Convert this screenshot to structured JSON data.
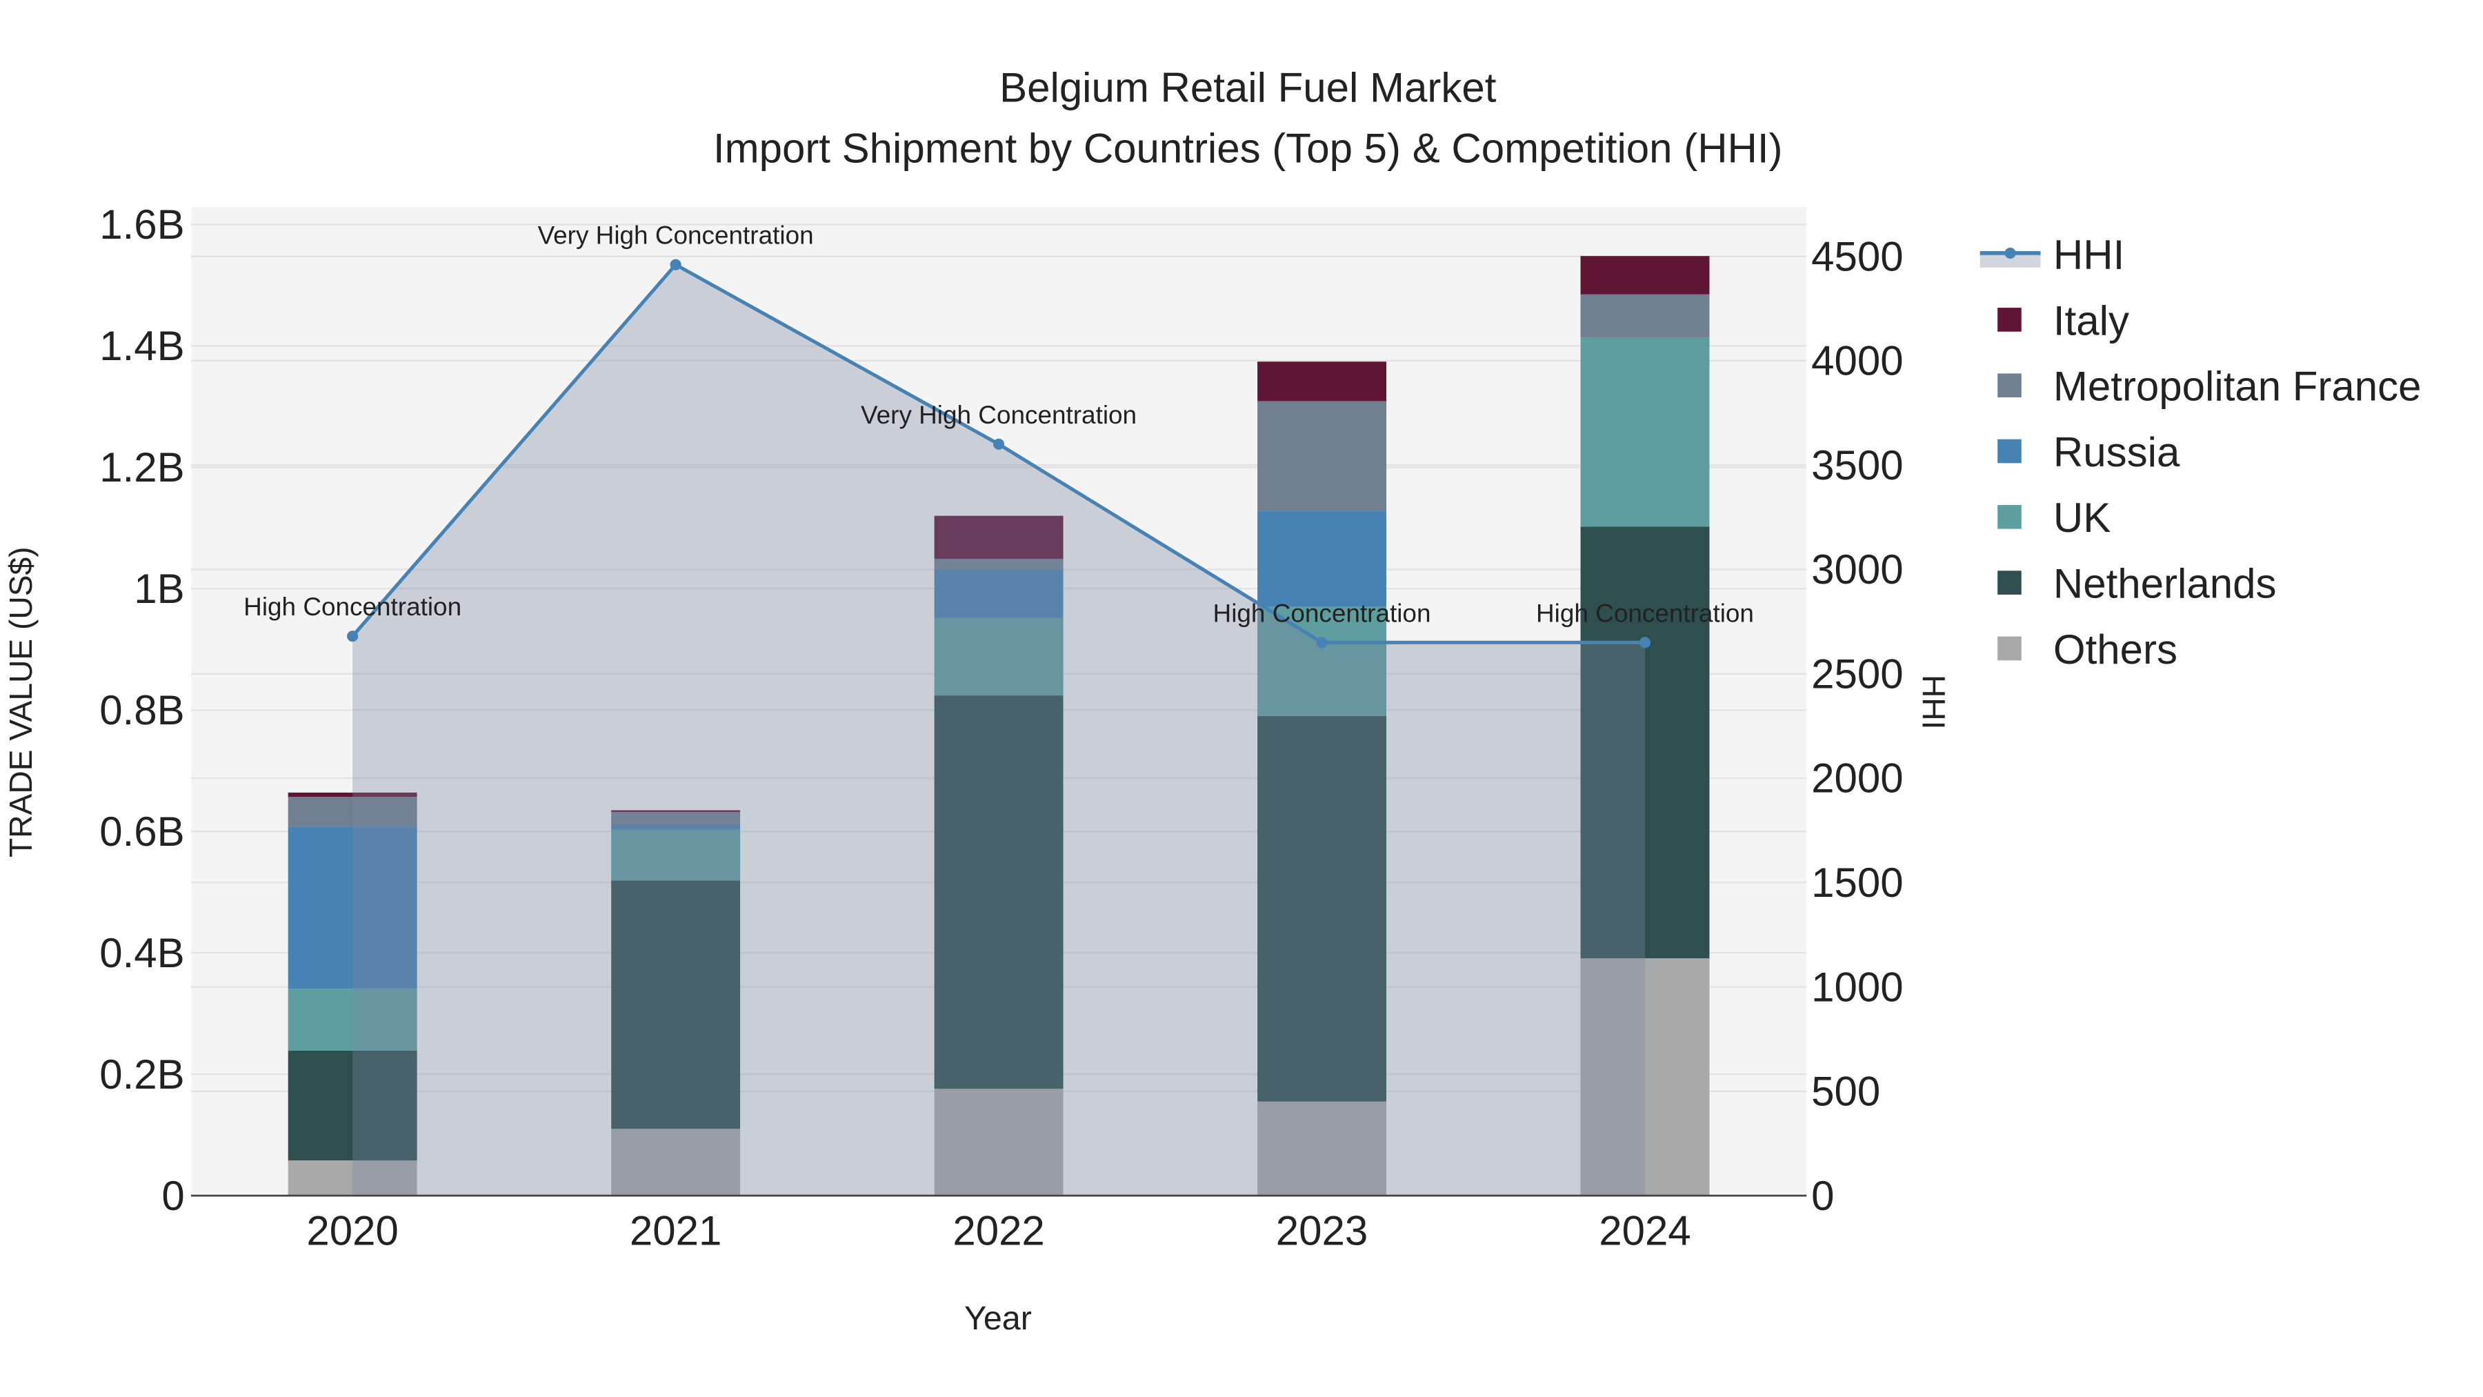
{
  "chart_data": {
    "type": "bar",
    "title": "Belgium Retail Fuel Market",
    "subtitle": "Import Shipment by Countries (Top 5) & Competition (HHI)",
    "xlabel": "Year",
    "ylabel": "TRADE VALUE (US$)",
    "y2label": "HHI",
    "categories": [
      "2020",
      "2021",
      "2022",
      "2023",
      "2024"
    ],
    "ylim": [
      0,
      1.6
    ],
    "yticks": [
      0,
      0.2,
      0.4,
      0.6,
      0.8,
      1.0,
      1.2,
      1.4,
      1.6
    ],
    "ytick_labels": [
      "0",
      "0.2B",
      "0.4B",
      "0.6B",
      "0.8B",
      "1B",
      "1.2B",
      "1.4B",
      "1.6B"
    ],
    "y2lim": [
      0,
      4500
    ],
    "y2ticks": [
      0,
      500,
      1000,
      1500,
      2000,
      2500,
      3000,
      3500,
      4000,
      4500
    ],
    "y2tick_labels": [
      "0",
      "500",
      "1000",
      "1500",
      "2000",
      "2500",
      "3000",
      "3500",
      "4000",
      "4500"
    ],
    "units": "billion US$",
    "series": [
      {
        "name": "Others",
        "color": "#a9a9a9",
        "values": [
          0.058,
          0.11,
          0.176,
          0.155,
          0.391
        ]
      },
      {
        "name": "Netherlands",
        "color": "#2f4f4f",
        "values": [
          0.181,
          0.409,
          0.648,
          0.635,
          0.711
        ]
      },
      {
        "name": "UK",
        "color": "#5f9ea0",
        "values": [
          0.102,
          0.084,
          0.128,
          0.18,
          0.312
        ]
      },
      {
        "name": "Russia",
        "color": "#4682b4",
        "values": [
          0.267,
          0.008,
          0.079,
          0.158,
          0.0
        ]
      },
      {
        "name": "Metropolitan France",
        "color": "#708090",
        "values": [
          0.049,
          0.021,
          0.018,
          0.181,
          0.071
        ]
      },
      {
        "name": "Italy",
        "color": "#601535",
        "values": [
          0.007,
          0.003,
          0.071,
          0.065,
          0.063
        ]
      }
    ],
    "hhi": {
      "name": "HHI",
      "color": "#4682b4",
      "values": [
        2680,
        4460,
        3600,
        2650,
        2650
      ],
      "annotations": [
        "High Concentration",
        "Very High Concentration",
        "Very High Concentration",
        "High Concentration",
        "High Concentration"
      ]
    },
    "legend_order": [
      "HHI",
      "Italy",
      "Metropolitan France",
      "Russia",
      "UK",
      "Netherlands",
      "Others"
    ],
    "legend_position": "right",
    "grid": true
  }
}
